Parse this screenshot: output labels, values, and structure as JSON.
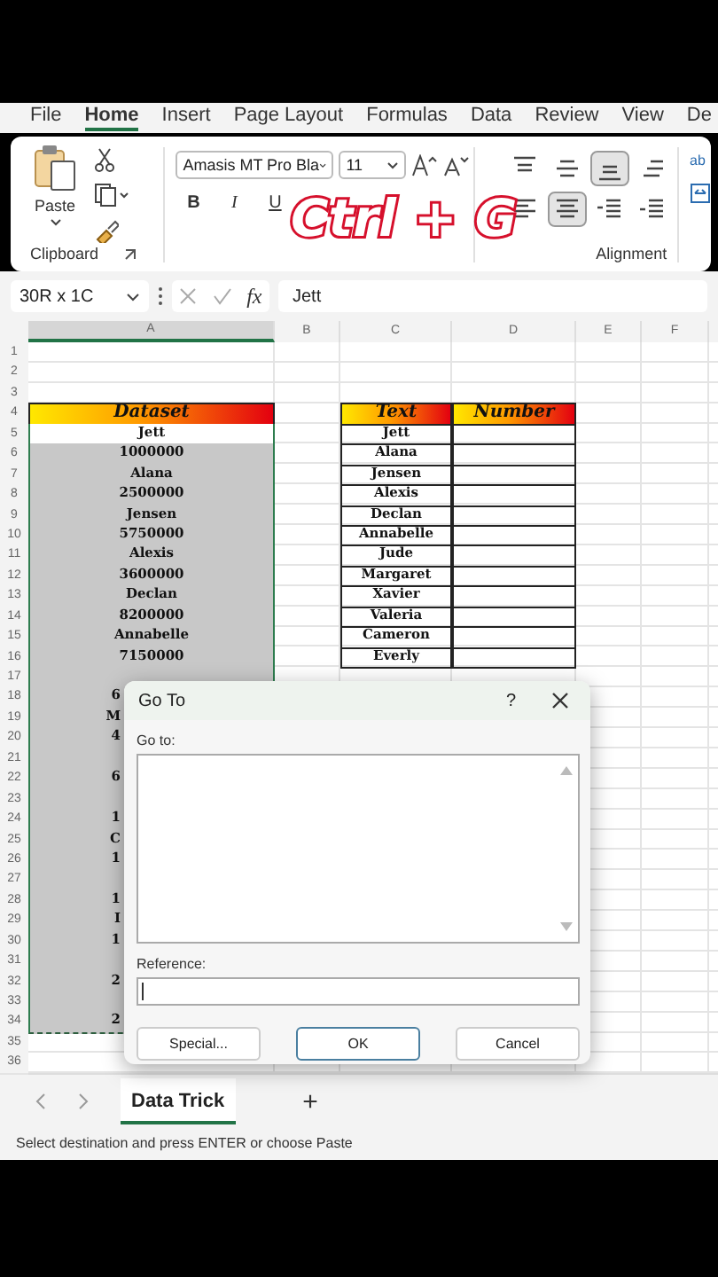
{
  "menu_tabs": [
    {
      "label": "File",
      "selected": false
    },
    {
      "label": "Home",
      "selected": true
    },
    {
      "label": "Insert",
      "selected": false
    },
    {
      "label": "Page Layout",
      "selected": false
    },
    {
      "label": "Formulas",
      "selected": false
    },
    {
      "label": "Data",
      "selected": false
    },
    {
      "label": "Review",
      "selected": false
    },
    {
      "label": "View",
      "selected": false
    },
    {
      "label": "De",
      "selected": false
    }
  ],
  "ribbon": {
    "clipboard": {
      "paste_label": "Paste",
      "group_label": "Clipboard"
    },
    "font": {
      "name": "Amasis MT Pro Bla",
      "size": "11",
      "style_buttons": [
        "B",
        "I",
        "U"
      ]
    },
    "alignment": {
      "group_label": "Alignment",
      "buttons": [
        {
          "kind": "top",
          "selected": false
        },
        {
          "kind": "middle",
          "selected": false
        },
        {
          "kind": "bottom",
          "selected": true
        },
        {
          "kind": "orientation",
          "selected": false
        },
        {
          "kind": "left",
          "selected": false
        },
        {
          "kind": "center",
          "selected": true
        },
        {
          "kind": "outdent",
          "selected": false
        },
        {
          "kind": "indent",
          "selected": false
        }
      ],
      "wrap_label": "ab"
    }
  },
  "overlay_caption": "Ctrl + G",
  "formula_bar": {
    "name_box": "30R x 1C",
    "function_label": "fx",
    "value": "Jett"
  },
  "sheet": {
    "columns": [
      {
        "label": "A",
        "selected": true
      },
      {
        "label": "B",
        "selected": false
      },
      {
        "label": "C",
        "selected": false
      },
      {
        "label": "D",
        "selected": false
      },
      {
        "label": "E",
        "selected": false
      },
      {
        "label": "F",
        "selected": false
      }
    ],
    "rows": [
      {
        "number": "1"
      },
      {
        "number": "2"
      },
      {
        "number": "3"
      },
      {
        "number": "4",
        "a": {
          "kind": "header",
          "text": "Dataset"
        },
        "c": {
          "kind": "header",
          "text": "Text"
        },
        "d": {
          "kind": "header",
          "text": "Number"
        }
      },
      {
        "number": "5",
        "a": {
          "kind": "active",
          "text": "Jett"
        },
        "c": {
          "kind": "table",
          "text": "Jett"
        },
        "d": {
          "kind": "table"
        }
      },
      {
        "number": "6",
        "a": {
          "kind": "selected",
          "text": "1000000"
        },
        "c": {
          "kind": "table",
          "text": "Alana"
        },
        "d": {
          "kind": "table"
        }
      },
      {
        "number": "7",
        "a": {
          "kind": "selected",
          "text": "Alana"
        },
        "c": {
          "kind": "table",
          "text": "Jensen"
        },
        "d": {
          "kind": "table"
        }
      },
      {
        "number": "8",
        "a": {
          "kind": "selected",
          "text": "2500000"
        },
        "c": {
          "kind": "table",
          "text": "Alexis"
        },
        "d": {
          "kind": "table"
        }
      },
      {
        "number": "9",
        "a": {
          "kind": "selected",
          "text": "Jensen"
        },
        "c": {
          "kind": "table",
          "text": "Declan"
        },
        "d": {
          "kind": "table"
        }
      },
      {
        "number": "10",
        "a": {
          "kind": "selected",
          "text": "5750000"
        },
        "c": {
          "kind": "table",
          "text": "Annabelle"
        },
        "d": {
          "kind": "table"
        }
      },
      {
        "number": "11",
        "a": {
          "kind": "selected",
          "text": "Alexis"
        },
        "c": {
          "kind": "table",
          "text": "Jude"
        },
        "d": {
          "kind": "table"
        }
      },
      {
        "number": "12",
        "a": {
          "kind": "selected",
          "text": "3600000"
        },
        "c": {
          "kind": "table",
          "text": "Margaret"
        },
        "d": {
          "kind": "table"
        }
      },
      {
        "number": "13",
        "a": {
          "kind": "selected",
          "text": "Declan"
        },
        "c": {
          "kind": "table",
          "text": "Xavier"
        },
        "d": {
          "kind": "table"
        }
      },
      {
        "number": "14",
        "a": {
          "kind": "selected",
          "text": "8200000"
        },
        "c": {
          "kind": "table",
          "text": "Valeria"
        },
        "d": {
          "kind": "table"
        }
      },
      {
        "number": "15",
        "a": {
          "kind": "selected",
          "text": "Annabelle"
        },
        "c": {
          "kind": "table",
          "text": "Cameron"
        },
        "d": {
          "kind": "table"
        }
      },
      {
        "number": "16",
        "a": {
          "kind": "selected",
          "text": "7150000"
        },
        "c": {
          "kind": "table",
          "text": "Everly"
        },
        "d": {
          "kind": "table"
        }
      },
      {
        "number": "17",
        "a": {
          "kind": "selected"
        }
      },
      {
        "number": "18",
        "a": {
          "kind": "clipped",
          "text": "6"
        }
      },
      {
        "number": "19",
        "a": {
          "kind": "clipped",
          "text": "M"
        }
      },
      {
        "number": "20",
        "a": {
          "kind": "clipped",
          "text": "4"
        }
      },
      {
        "number": "21",
        "a": {
          "kind": "selected"
        }
      },
      {
        "number": "22",
        "a": {
          "kind": "clipped",
          "text": "6"
        }
      },
      {
        "number": "23",
        "a": {
          "kind": "selected"
        }
      },
      {
        "number": "24",
        "a": {
          "kind": "clipped",
          "text": "1"
        }
      },
      {
        "number": "25",
        "a": {
          "kind": "clipped",
          "text": "C"
        }
      },
      {
        "number": "26",
        "a": {
          "kind": "clipped",
          "text": "1"
        }
      },
      {
        "number": "27",
        "a": {
          "kind": "selected"
        }
      },
      {
        "number": "28",
        "a": {
          "kind": "clipped",
          "text": "1"
        }
      },
      {
        "number": "29",
        "a": {
          "kind": "clipped",
          "text": "I"
        }
      },
      {
        "number": "30",
        "a": {
          "kind": "clipped",
          "text": "1"
        }
      },
      {
        "number": "31",
        "a": {
          "kind": "selected"
        }
      },
      {
        "number": "32",
        "a": {
          "kind": "clipped",
          "text": "2"
        }
      },
      {
        "number": "33",
        "a": {
          "kind": "selected"
        }
      },
      {
        "number": "34",
        "a": {
          "kind": "clipped",
          "text": "2"
        }
      },
      {
        "number": "35"
      },
      {
        "number": "36"
      }
    ]
  },
  "dialog": {
    "title": "Go To",
    "help": "?",
    "goto_label": "Go to:",
    "reference_label": "Reference:",
    "buttons": [
      {
        "label": "Special...",
        "default": false
      },
      {
        "label": "OK",
        "default": true
      },
      {
        "label": "Cancel",
        "default": false
      }
    ]
  },
  "sheet_tabs": [
    {
      "label": "Data Trick",
      "selected": true
    }
  ],
  "add_sheet": "+",
  "status_bar": "Select destination and press ENTER or choose Paste"
}
